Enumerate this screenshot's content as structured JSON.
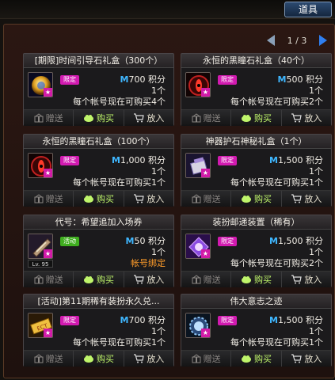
{
  "header": {
    "active_tab": "道具"
  },
  "pager": {
    "text": "1 / 3"
  },
  "buttons": {
    "gift": "赠送",
    "buy": "购买",
    "cart": "放入"
  },
  "currency_mark": "M",
  "points_unit": "积分",
  "items": [
    {
      "title": "[期限]时间引导石礼盒（300个）",
      "badge": "限定",
      "badge_type": "limit",
      "price": "700",
      "qty": "1个",
      "limit": "每个帐号现在可购买4个",
      "icon": "golden-orb-icon",
      "gift_enabled": false
    },
    {
      "title": "永恒的黑瞳石礼盒（40个）",
      "badge": "限定",
      "badge_type": "limit",
      "price": "500",
      "qty": "1个",
      "limit": "每个帐号现在可购买2个",
      "icon": "dark-eye-stone-icon",
      "gift_enabled": false
    },
    {
      "title": "永恒的黑瞳石礼盒（100个）",
      "badge": "限定",
      "badge_type": "limit",
      "price": "1,000",
      "qty": "1个",
      "limit": "每个帐号现在可购买1个",
      "icon": "dark-eye-stone-icon",
      "gift_enabled": false
    },
    {
      "title": "神器护石神秘礼盒（1个）",
      "badge": "限定",
      "badge_type": "limit",
      "price": "1,500",
      "qty": "1个",
      "limit": "每个帐号现在可购买1个",
      "icon": "mystic-box-icon",
      "gift_enabled": false
    },
    {
      "title": "代号：希望追加入场券",
      "badge": "活动",
      "badge_type": "event",
      "price": "50",
      "qty": "1个",
      "limit": "帐号绑定",
      "limit_bound": true,
      "level": "Lv. 95",
      "icon": "ticket-icon",
      "gift_enabled": false
    },
    {
      "title": "装扮邮递装置（稀有）",
      "badge": "限定",
      "badge_type": "limit",
      "price": "1,500",
      "qty": "1个",
      "limit": "每个帐号现在可购买2个",
      "icon": "mail-device-icon",
      "gift_enabled": false
    },
    {
      "title": "[活动]第11期稀有装扮永久兑...",
      "badge": "限定",
      "badge_type": "limit",
      "price": "700",
      "qty": "1个",
      "limit": "每个帐号现在可购买1个",
      "icon": "coupon-icon",
      "gift_enabled": false
    },
    {
      "title": "伟大意志之迹",
      "badge": "限定",
      "badge_type": "limit",
      "price": "1,500",
      "qty": "1个",
      "limit": "每个帐号现在可购买1个",
      "icon": "will-gear-icon",
      "gift_enabled": false
    }
  ]
}
